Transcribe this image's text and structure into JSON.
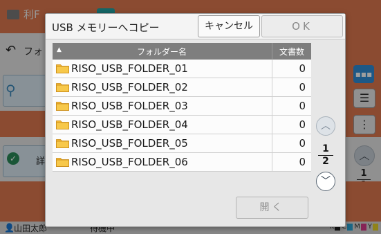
{
  "background": {
    "app_title": "利F",
    "back_label": "フォ",
    "detail_label": "詳",
    "user_name": "山田太郎",
    "status": "待機中",
    "page_current": "1",
    "page_total": "1",
    "toner": [
      {
        "label": "K",
        "color": "#222222"
      },
      {
        "label": "C",
        "color": "#2aa7d8"
      },
      {
        "label": "M",
        "color": "#d83a8c"
      },
      {
        "label": "Y",
        "color": "#e8d32b"
      }
    ]
  },
  "dialog": {
    "title": "USB メモリーへコピー",
    "cancel_label": "キャンセル",
    "ok_label": "OK",
    "open_label": "開く",
    "table": {
      "header_name": "フォルダー名",
      "header_count": "文書数",
      "sort_indicator": "▲",
      "rows": [
        {
          "name": "RISO_USB_FOLDER_01",
          "count": "0"
        },
        {
          "name": "RISO_USB_FOLDER_02",
          "count": "0"
        },
        {
          "name": "RISO_USB_FOLDER_03",
          "count": "0"
        },
        {
          "name": "RISO_USB_FOLDER_04",
          "count": "0"
        },
        {
          "name": "RISO_USB_FOLDER_05",
          "count": "0"
        },
        {
          "name": "RISO_USB_FOLDER_06",
          "count": "0"
        }
      ]
    },
    "pager": {
      "current": "1",
      "total": "2"
    }
  },
  "colors": {
    "accent_orange": "#e1794f",
    "folder_yellow": "#f2b632",
    "header_gray": "#7e7e7e"
  }
}
